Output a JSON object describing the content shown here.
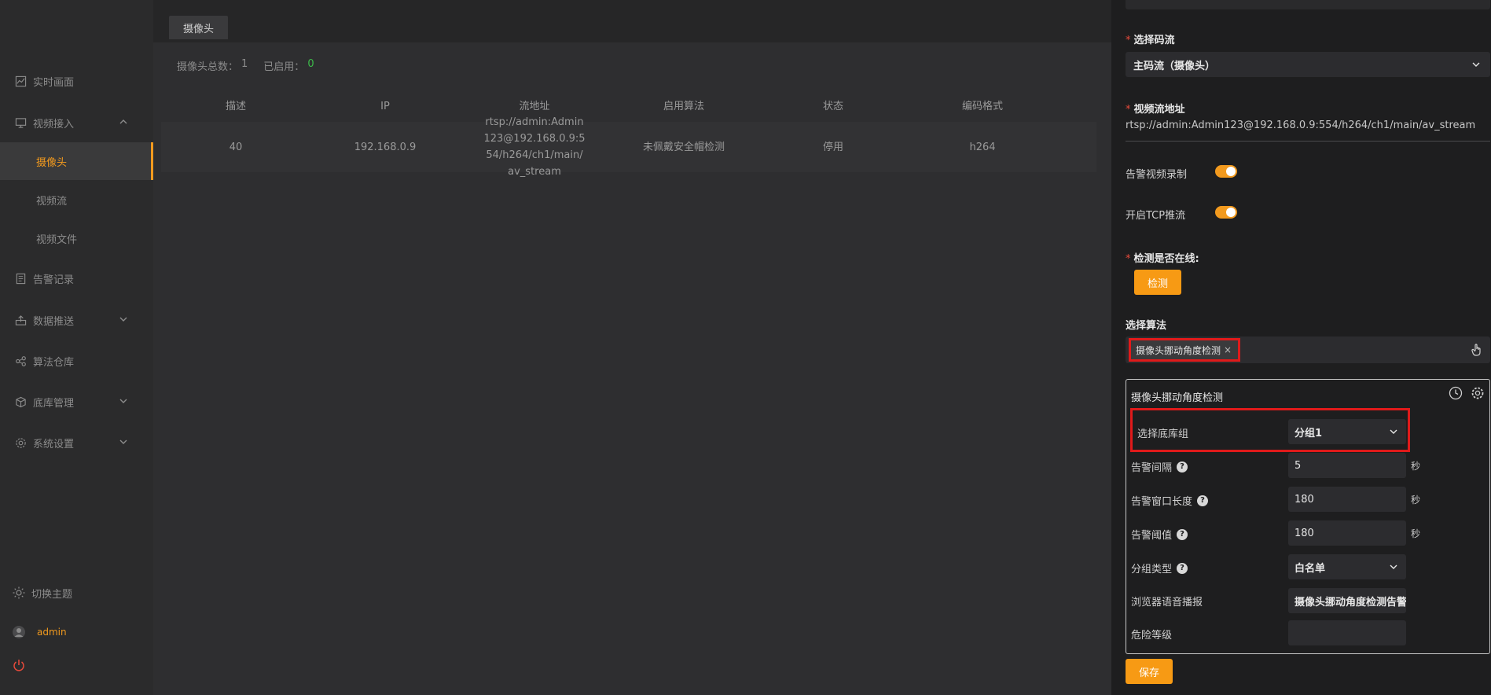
{
  "sidebar": {
    "items": [
      {
        "label": "实时画面",
        "icon": "chart-line-icon"
      },
      {
        "label": "视频接入",
        "icon": "monitor-icon"
      },
      {
        "label": "告警记录",
        "icon": "document-icon"
      },
      {
        "label": "数据推送",
        "icon": "upload-icon"
      },
      {
        "label": "算法仓库",
        "icon": "algorithm-icon"
      },
      {
        "label": "底库管理",
        "icon": "cube-icon"
      },
      {
        "label": "系统设置",
        "icon": "gear-icon"
      }
    ],
    "sub_items": [
      "摄像头",
      "视频流",
      "视频文件"
    ],
    "theme_label": "切换主题",
    "user_name": "admin"
  },
  "main": {
    "tab_label": "摄像头",
    "stats": {
      "total_label": "摄像头总数：",
      "total_value": "1",
      "enabled_label": "已启用：",
      "enabled_value": "0"
    },
    "table": {
      "headers": [
        "描述",
        "IP",
        "流地址",
        "启用算法",
        "状态",
        "编码格式"
      ],
      "rows": [
        [
          "40",
          "192.168.0.9",
          "rtsp://admin:Admin123@192.168.0.9:554/h264/ch1/main/av_stream",
          "未佩戴安全帽检测",
          "停用",
          "h264"
        ]
      ]
    }
  },
  "drawer": {
    "stream_label": "选择码流",
    "stream_value": "主码流（摄像头）",
    "url_label": "视频流地址",
    "url_value": "rtsp://admin:Admin123@192.168.0.9:554/h264/ch1/main/av_stream",
    "alarm_record_label": "告警视频录制",
    "tcp_label": "开启TCP推流",
    "online_label": "检测是否在线:",
    "check_button": "检测",
    "algo_label": "选择算法",
    "algo_tag": "摄像头挪动角度检测",
    "config": {
      "title": "摄像头挪动角度检测",
      "group_label": "选择底库组",
      "group_value": "分组1",
      "interval_label": "告警间隔",
      "interval_value": "5",
      "window_label": "告警窗口长度",
      "window_value": "180",
      "threshold_label": "告警阈值",
      "threshold_value": "180",
      "unit": "秒",
      "group_type_label": "分组类型",
      "group_type_value": "白名单",
      "voice_label": "浏览器语音播报",
      "voice_value": "摄像头挪动角度检测告警",
      "danger_label": "危险等级",
      "danger_value": ""
    },
    "save_button": "保存"
  }
}
